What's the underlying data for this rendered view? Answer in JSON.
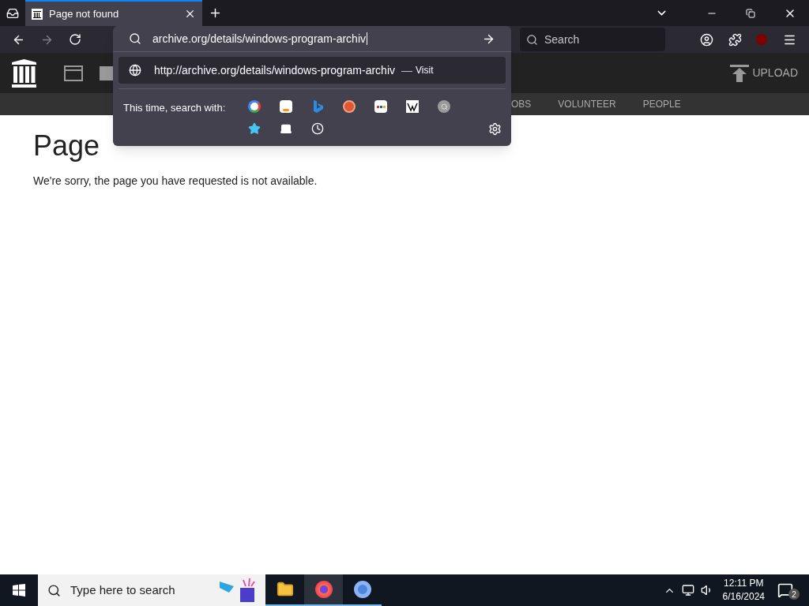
{
  "tabs": [
    {
      "title": "Page not found",
      "selected": true
    }
  ],
  "address_bar": {
    "value": "archive.org/details/windows-program-archiv"
  },
  "suggestion": {
    "url": "http://archive.org/details/windows-program-archiv",
    "separator": "—",
    "action": "Visit"
  },
  "search_with": {
    "label": "This time, search with:",
    "engines": [
      {
        "kind": "google"
      },
      {
        "kind": "amazon"
      },
      {
        "kind": "bing"
      },
      {
        "kind": "duckduckgo"
      },
      {
        "kind": "ebay"
      },
      {
        "kind": "wikipedia"
      },
      {
        "kind": "generic"
      },
      {
        "kind": "bookmarks"
      },
      {
        "kind": "tabs"
      },
      {
        "kind": "history"
      }
    ]
  },
  "search_field": {
    "placeholder": "Search"
  },
  "site_header": {
    "upload": "UPLOAD",
    "nav": [
      "OBS",
      "VOLUNTEER",
      "PEOPLE"
    ]
  },
  "page": {
    "heading": "Page",
    "message": "We're sorry, the page you have requested is not available."
  },
  "taskbar": {
    "search_placeholder": "Type here to search",
    "apps": [
      {
        "kind": "explorer",
        "selected": false
      },
      {
        "kind": "firefox",
        "selected": true
      },
      {
        "kind": "chromium",
        "selected": false
      }
    ],
    "time": "12:11 PM",
    "date": "6/16/2024",
    "notifications": "2"
  }
}
